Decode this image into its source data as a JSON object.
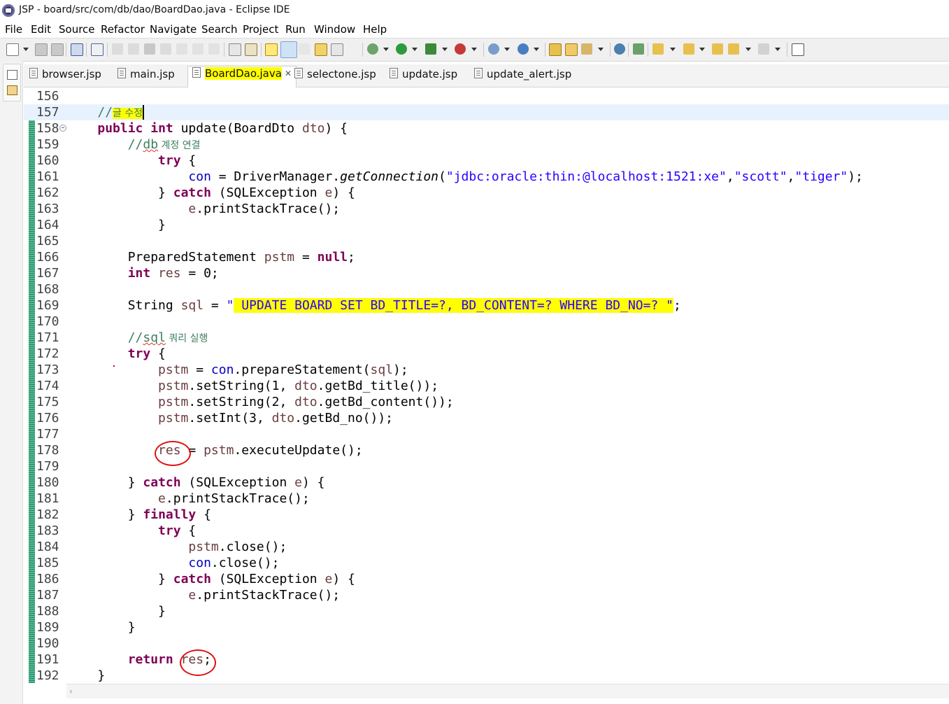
{
  "window": {
    "title": "JSP - board/src/com/db/dao/BoardDao.java - Eclipse IDE"
  },
  "menu": [
    {
      "label": "File"
    },
    {
      "label": "Edit"
    },
    {
      "label": "Source"
    },
    {
      "label": "Refactor"
    },
    {
      "label": "Navigate"
    },
    {
      "label": "Search"
    },
    {
      "label": "Project"
    },
    {
      "label": "Run"
    },
    {
      "label": "Window"
    },
    {
      "label": "Help"
    }
  ],
  "toolbar": {
    "icons": [
      "new-icon",
      "save-icon",
      "save-all-icon",
      "terminal-icon",
      "skip-breakpoints-icon",
      "resume-icon",
      "suspend-icon",
      "terminate-icon",
      "disconnect-icon",
      "step-into-icon",
      "step-over-icon",
      "step-return-icon",
      "drop-to-frame-icon",
      "use-step-filters-icon",
      "toggle-mark-occurrences-icon",
      "toggle-highlight-icon",
      "toggle-block-selection-icon",
      "show-whitespace-icon",
      "debug-icon",
      "run-icon",
      "run-server-icon",
      "coverage-icon",
      "external-tools-icon",
      "new-java-class-icon",
      "open-type-icon",
      "open-task-icon",
      "search-icon",
      "globe-icon",
      "open-perspective-icon",
      "next-annotation-icon",
      "previous-annotation-icon",
      "last-edit-location-icon",
      "back-icon",
      "forward-icon",
      "maximize-icon"
    ]
  },
  "tabs": [
    {
      "label": "browser.jsp",
      "active": false
    },
    {
      "label": "main.jsp",
      "active": false
    },
    {
      "label": "BoardDao.java",
      "active": true,
      "close": "✕"
    },
    {
      "label": "selectone.jsp",
      "active": false
    },
    {
      "label": "update.jsp",
      "active": false
    },
    {
      "label": "update_alert.jsp",
      "active": false
    }
  ],
  "editor": {
    "lines": [
      {
        "num": "156"
      },
      {
        "num": "157"
      },
      {
        "num": "158"
      },
      {
        "num": "159"
      },
      {
        "num": "160"
      },
      {
        "num": "161"
      },
      {
        "num": "162"
      },
      {
        "num": "163"
      },
      {
        "num": "164"
      },
      {
        "num": "165"
      },
      {
        "num": "166"
      },
      {
        "num": "167"
      },
      {
        "num": "168"
      },
      {
        "num": "169"
      },
      {
        "num": "170"
      },
      {
        "num": "171"
      },
      {
        "num": "172"
      },
      {
        "num": "173"
      },
      {
        "num": "174"
      },
      {
        "num": "175"
      },
      {
        "num": "176"
      },
      {
        "num": "177"
      },
      {
        "num": "178"
      },
      {
        "num": "179"
      },
      {
        "num": "180"
      },
      {
        "num": "181"
      },
      {
        "num": "182"
      },
      {
        "num": "183"
      },
      {
        "num": "184"
      },
      {
        "num": "185"
      },
      {
        "num": "186"
      },
      {
        "num": "187"
      },
      {
        "num": "188"
      },
      {
        "num": "189"
      },
      {
        "num": "190"
      },
      {
        "num": "191"
      },
      {
        "num": "192"
      }
    ],
    "tokens": {
      "c157_slashes": "//",
      "c157_text": "글 수정",
      "kw_public": "public",
      "kw_int": "int",
      "c158_rest": " update(BoardDto ",
      "dto": "dto",
      "c158_end": ") {",
      "c159_slashes": "//",
      "c159_db": "db",
      "c159_text": " 계정 연결",
      "kw_try": "try",
      "brace_open": " {",
      "con": "con",
      "c161_mid": " = DriverManager.",
      "getConnection": "getConnection",
      "paren_open": "(",
      "s_url": "\"jdbc:oracle:thin:@localhost:1521:xe\"",
      "comma": ",",
      "s_user": "\"scott\"",
      "s_pass": "\"tiger\"",
      "c161_end": ");",
      "close_brace": "} ",
      "kw_catch": "catch",
      "c162_rest": " (SQLException ",
      "e": "e",
      "c162_end": ") {",
      "print_trace": ".printStackTrace();",
      "brace_close": "}",
      "c166_type": "PreparedStatement ",
      "pstm": "pstm",
      "equals": " = ",
      "kw_null": "null",
      "semi": ";",
      "res": "res",
      "c167_end": " = 0;",
      "c169_type": "String ",
      "sql": "sql",
      "c169_eq": " = ",
      "quote": "\"",
      "s_sql_body": " UPDATE BOARD SET BD_TITLE=?, BD_CONTENT=? WHERE BD_NO=? ",
      "c171_slashes": "//",
      "c171_sql": "sql",
      "c171_text": " 쿼리 실행",
      "c173_call": ".prepareStatement(",
      "c173_end": ");",
      "c174_call": ".setString(1, ",
      "c174_get": ".getBd_title());",
      "c175_call": ".setString(2, ",
      "c175_get": ".getBd_content());",
      "c176_call": ".setInt(3, ",
      "c176_get": ".getBd_no());",
      "c178_mid": " = ",
      "c178_end": ".executeUpdate();",
      "kw_finally": "finally",
      "close_call": ".close();",
      "kw_return": "return",
      "return_end": ";",
      "c180_pre": "} ",
      "c182_pre": "} "
    }
  },
  "colors": {
    "keyword": "#7f0055",
    "comment": "#3f7f5f",
    "string": "#2a00ff",
    "field": "#0000c0",
    "highlight": "#ffff00",
    "annotation": "#e01010"
  }
}
